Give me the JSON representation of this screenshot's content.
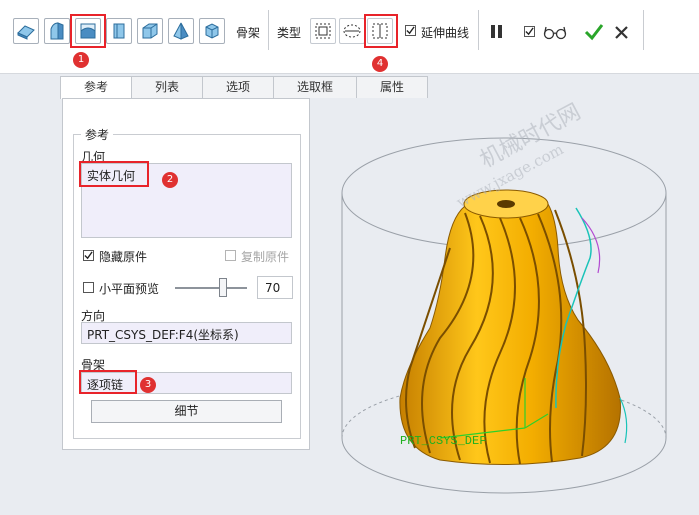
{
  "toolbar": {
    "tools": [
      {
        "icon": "solid-blade-icon"
      },
      {
        "icon": "half-body-icon"
      },
      {
        "icon": "blend-shell-icon"
      },
      {
        "icon": "cube-slot-icon"
      },
      {
        "icon": "folded-plate-icon"
      },
      {
        "icon": "pyramid-icon"
      },
      {
        "icon": "hexagon-prism-icon"
      }
    ],
    "skeleton_label": "骨架",
    "type_label": "类型",
    "type_tools": [
      {
        "icon": "dashed-rect-icon"
      },
      {
        "icon": "dashed-ellipse-rect-icon"
      },
      {
        "icon": "dashed-vertical-section-icon"
      }
    ],
    "extend_curve_label": "延伸曲线",
    "extend_curve_checked": true,
    "pause_icon": "pause-icon",
    "preview_checked": true,
    "glasses_icon": "glasses-icon",
    "ok_icon": "check-icon",
    "cancel_icon": "close-icon"
  },
  "tabs": [
    "参考",
    "列表",
    "选项",
    "选取框",
    "属性"
  ],
  "active_tab": "参考",
  "panel": {
    "group_title": "参考",
    "geometry_label": "几何",
    "geometry_value": "实体几何",
    "hide_original_label": "隐藏原件",
    "hide_original_checked": true,
    "copy_original_label": "复制原件",
    "copy_original_checked": false,
    "small_plane_label": "小平面预览",
    "small_plane_checked": false,
    "slider_value": "70",
    "direction_label": "方向",
    "direction_value": "PRT_CSYS_DEF:F4(坐标系)",
    "skeleton_label": "骨架",
    "skeleton_value": "逐项链",
    "details_button": "细节"
  },
  "callouts": [
    "1",
    "2",
    "3",
    "4"
  ],
  "watermark": {
    "line1": "机械时代网",
    "line2": "www.jxage.com"
  },
  "model": {
    "csys_label": "PRT_CSYS_DEF"
  },
  "colors": {
    "accent": "#e8232a",
    "model_gold": "#f3ad00",
    "model_dark": "#9a6a00",
    "ok_green": "#2aa52a"
  }
}
